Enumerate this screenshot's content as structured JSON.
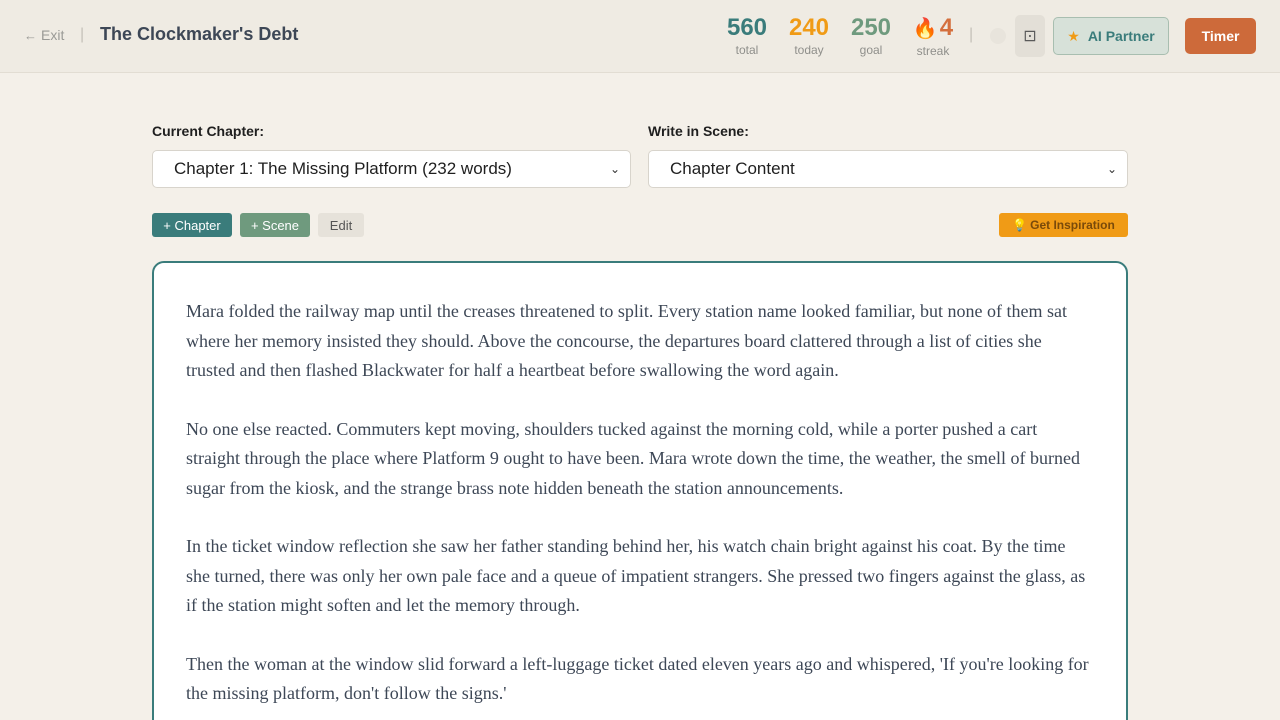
{
  "header": {
    "exit_label": "Exit",
    "title": "The Clockmaker's Debt",
    "stats": {
      "total": {
        "value": "560",
        "label": "total"
      },
      "today": {
        "value": "240",
        "label": "today"
      },
      "goal": {
        "value": "250",
        "label": "goal"
      },
      "streak": {
        "value": "4",
        "label": "streak"
      }
    },
    "ai_partner_label": "AI Partner",
    "timer_label": "Timer"
  },
  "selectors": {
    "chapter_label": "Current Chapter:",
    "chapter_value": "Chapter 1: The Missing Platform (232 words)",
    "scene_label": "Write in Scene:",
    "scene_value": "Chapter Content"
  },
  "actions": {
    "add_chapter": "+ Chapter",
    "add_scene": "+ Scene",
    "edit": "Edit",
    "inspiration": "Get Inspiration"
  },
  "editor": {
    "paragraphs": [
      "Mara folded the railway map until the creases threatened to split. Every station name looked familiar, but none of them sat where her memory insisted they should. Above the concourse, the departures board clattered through a list of cities she trusted and then flashed Blackwater for half a heartbeat before swallowing the word again.",
      "No one else reacted. Commuters kept moving, shoulders tucked against the morning cold, while a porter pushed a cart straight through the place where Platform 9 ought to have been. Mara wrote down the time, the weather, the smell of burned sugar from the kiosk, and the strange brass note hidden beneath the station announcements.",
      "In the ticket window reflection she saw her father standing behind her, his watch chain bright against his coat. By the time she turned, there was only her own pale face and a queue of impatient strangers. She pressed two fingers against the glass, as if the station might soften and let the memory through.",
      "Then the woman at the window slid forward a left-luggage ticket dated eleven years ago and whispered, 'If you're looking for the missing platform, don't follow the signs.'"
    ]
  },
  "colors": {
    "accent_teal": "#3a7c7b",
    "accent_orange": "#f09b16",
    "accent_green": "#6f9a7e",
    "accent_rust": "#cd6a3a"
  },
  "icons": {
    "exit": "arrow-left-icon",
    "streak": "flame-icon",
    "focus": "focus-mode-icon",
    "ai": "star-icon",
    "inspiration": "lightbulb-icon"
  }
}
